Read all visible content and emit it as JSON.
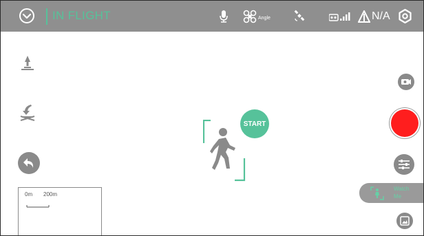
{
  "topbar": {
    "status": "IN FLIGHT",
    "mode_label": "Angle",
    "altitude": "N/A"
  },
  "actions": {
    "start_label": "START",
    "watch_label_line1": "Watch",
    "watch_label_line2": "Me"
  },
  "map": {
    "scale_start": "0m",
    "scale_end": "200m"
  },
  "colors": {
    "accent": "#56c29a",
    "topbar": "#8f8f8f",
    "record": "#ff1e1e",
    "icon_gray": "#8a8a8a"
  },
  "icons": [
    "drone-status-icon",
    "microphone-icon",
    "propeller-icon",
    "satellite-icon",
    "remote-signal-icon",
    "altitude-icon",
    "settings-icon",
    "takeoff-icon",
    "landing-icon",
    "return-home-icon",
    "camera-switch-icon",
    "record-button",
    "adjust-icon",
    "person-tracking-icon",
    "gallery-icon"
  ]
}
